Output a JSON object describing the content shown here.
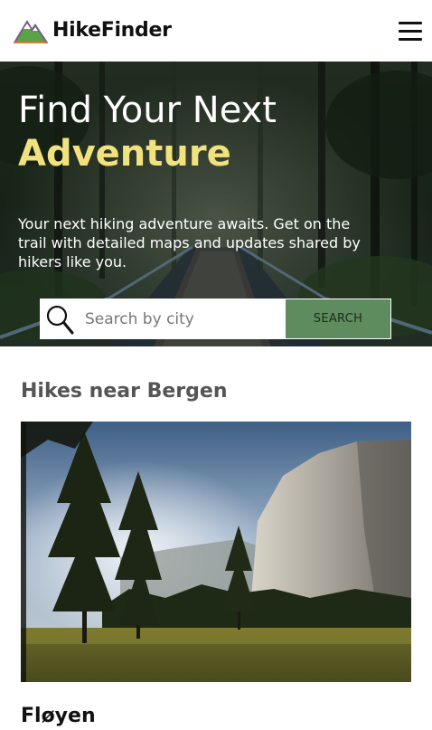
{
  "header": {
    "brand": "HikeFinder",
    "logo_icon": "mountain-logo-icon",
    "menu_icon": "hamburger-menu-icon"
  },
  "hero": {
    "title_line1": "Find Your Next",
    "title_line2": "Adventure",
    "description": "Your next hiking adventure awaits. Get on the trail with detailed maps and updates shared by hikers like you.",
    "search": {
      "placeholder": "Search by city",
      "value": "",
      "button_label": "SEARCH",
      "icon": "search-icon"
    }
  },
  "main": {
    "section_title": "Hikes near Bergen",
    "hikes": [
      {
        "name": "Fløyen"
      }
    ]
  },
  "colors": {
    "accent_yellow": "#f2e27e",
    "button_green": "#5e8c5f",
    "heading_gray": "#555555"
  }
}
